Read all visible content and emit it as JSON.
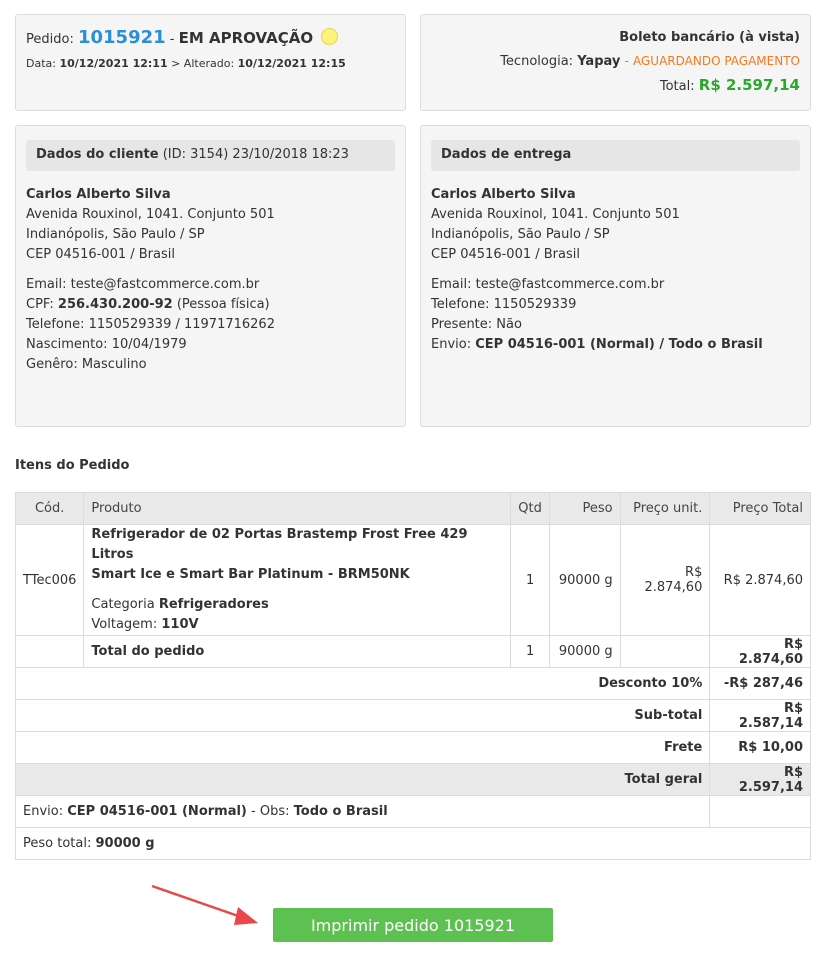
{
  "order": {
    "label": "Pedido:",
    "number": "1015921",
    "separator": "-",
    "status": "EM APROVAÇÃO",
    "status_color": "#fdf27a",
    "date_label": "Data:",
    "date": "10/12/2021 12:11",
    "altered_label": "> Alterado:",
    "altered": "10/12/2021 12:15"
  },
  "payment": {
    "method": "Boleto bancário (à vista)",
    "tech_label": "Tecnologia:",
    "tech": "Yapay",
    "tech_sep": "-",
    "tech_status": "AGUARDANDO PAGAMENTO",
    "total_label": "Total:",
    "total": "R$ 2.597,14"
  },
  "client": {
    "title": "Dados do cliente",
    "meta": "(ID: 3154) 23/10/2018 18:23",
    "name": "Carlos Alberto Silva",
    "address1": "Avenida Rouxinol, 1041. Conjunto 501",
    "address2": "Indianópolis, São Paulo / SP",
    "address3": "CEP 04516-001 / Brasil",
    "email_label": "Email:",
    "email": "teste@fastcommerce.com.br",
    "cpf_label": "CPF:",
    "cpf": "256.430.200-92",
    "cpf_type": "(Pessoa física)",
    "phone_label": "Telefone:",
    "phone": "1150529339 / 11971716262",
    "birth_label": "Nascimento:",
    "birth": "10/04/1979",
    "gender_label": "Genêro:",
    "gender": "Masculino"
  },
  "delivery": {
    "title": "Dados de entrega",
    "name": "Carlos Alberto Silva",
    "address1": "Avenida Rouxinol, 1041. Conjunto 501",
    "address2": "Indianópolis, São Paulo / SP",
    "address3": "CEP 04516-001 / Brasil",
    "email_label": "Email:",
    "email": "teste@fastcommerce.com.br",
    "phone_label": "Telefone:",
    "phone": "1150529339",
    "gift_label": "Presente:",
    "gift": "Não",
    "shipping_label": "Envio:",
    "shipping": "CEP 04516-001 (Normal) / Todo o Brasil"
  },
  "items": {
    "title": "Itens do Pedido",
    "columns": [
      "Cód.",
      "Produto",
      "Qtd",
      "Peso",
      "Preço unit.",
      "Preço Total"
    ],
    "product": {
      "code": "TTec006",
      "name_line1": "Refrigerador de 02 Portas Brastemp Frost Free 429 Litros",
      "name_line2": "Smart Ice e Smart Bar Platinum - BRM50NK",
      "category_label": "Categoria",
      "category": "Refrigeradores",
      "voltage_label": "Voltagem:",
      "voltage": "110V",
      "qty": "1",
      "weight": "90000 g",
      "unit_price": "R$ 2.874,60",
      "total_price": "R$ 2.874,60"
    },
    "order_total": {
      "label": "Total do pedido",
      "qty": "1",
      "weight": "90000 g",
      "value": "R$ 2.874,60"
    },
    "discount": {
      "label": "Desconto 10%",
      "value": "-R$ 287,46"
    },
    "subtotal": {
      "label": "Sub-total",
      "value": "R$ 2.587,14"
    },
    "freight": {
      "label": "Frete",
      "value": "R$ 10,00"
    },
    "grand_total": {
      "label": "Total geral",
      "value": "R$ 2.597,14"
    },
    "shipping_row": {
      "label": "Envio:",
      "value": "CEP 04516-001 (Normal)",
      "obs_label": "- Obs:",
      "obs": "Todo o Brasil"
    },
    "weight_row": {
      "label": "Peso total:",
      "value": "90000 g"
    }
  },
  "print_button": {
    "label": "Imprimir pedido 1015921",
    "color": "#5cc150"
  },
  "annotation": {
    "arrow_color": "#e8484a"
  }
}
